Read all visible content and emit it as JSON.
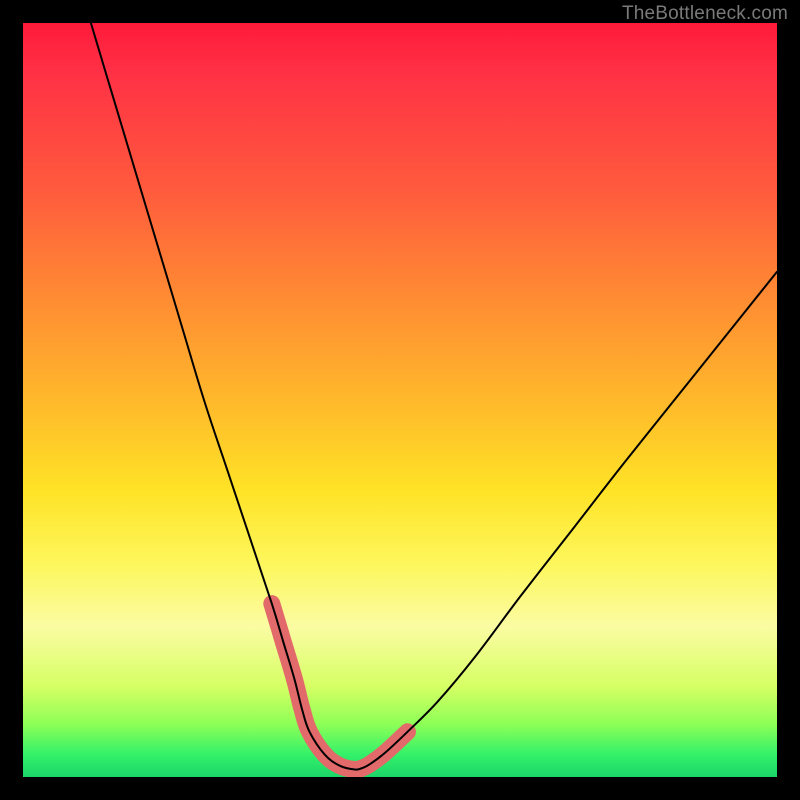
{
  "watermark": "TheBottleneck.com",
  "colors": {
    "frame_bg": "#000000",
    "curve": "#000000",
    "highlight": "#e26a6a",
    "gradient_top": "#ff1a3a",
    "gradient_bottom": "#1bd569"
  },
  "chart_data": {
    "type": "line",
    "title": "",
    "xlabel": "",
    "ylabel": "",
    "xlim": [
      0,
      100
    ],
    "ylim": [
      0,
      100
    ],
    "notes": "Plot area uses a vertical heat gradient (red at top through yellow to green at bottom). A single black V-shaped curve descends steeply from the top-left, bottoms out near the lower-center, then rises toward the right edge at roughly 60% height. A thick salmon-colored stroke highlights the bottom ~7% of the curve on both sides of the minimum.",
    "series": [
      {
        "name": "curve",
        "x": [
          9,
          12,
          15,
          18,
          21,
          24,
          27,
          30,
          33,
          34.5,
          36,
          37,
          38,
          40,
          42,
          44,
          45,
          46,
          48,
          51,
          55,
          60,
          66,
          73,
          80,
          88,
          96,
          100
        ],
        "y": [
          100,
          90,
          80,
          70,
          60,
          50,
          41,
          32,
          23,
          18,
          13,
          9,
          6,
          3,
          1.5,
          1,
          1.2,
          1.7,
          3.2,
          6,
          10,
          16,
          24,
          33,
          42,
          52,
          62,
          67
        ]
      }
    ],
    "highlight_range_x": [
      33.5,
      48
    ],
    "minimum": {
      "x": 44,
      "y": 1
    }
  }
}
